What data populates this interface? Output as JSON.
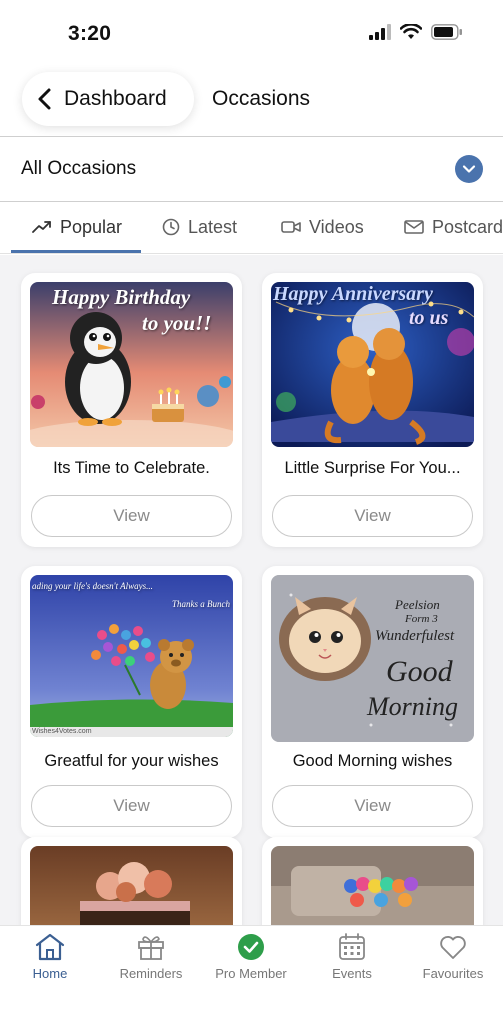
{
  "status_bar": {
    "time": "3:20"
  },
  "header": {
    "back_label": "Dashboard",
    "title": "Occasions"
  },
  "filter": {
    "label": "All Occasions"
  },
  "tabs": [
    {
      "label": "Popular",
      "icon": "trending-icon",
      "active": true
    },
    {
      "label": "Latest",
      "icon": "clock-icon",
      "active": false
    },
    {
      "label": "Videos",
      "icon": "video-icon",
      "active": false
    },
    {
      "label": "Postcard",
      "icon": "mail-icon",
      "active": false
    }
  ],
  "cards": [
    {
      "title": "Its Time to Celebrate.",
      "button": "View",
      "image_text": [
        "Happy Birthday",
        "to you!!"
      ]
    },
    {
      "title": "Little Surprise For You...",
      "button": "View",
      "image_text": [
        "Happy Anniversary",
        "to us"
      ]
    },
    {
      "title": "Greatful for your wishes",
      "button": "View",
      "image_text": [
        "ading your life's doesn't Always...",
        "Thanks a Bunch",
        "Wishes4Votes.com"
      ]
    },
    {
      "title": "Good Morning wishes",
      "button": "View",
      "image_text": [
        "Peelsion",
        "Form 3",
        "Wunderfulest",
        "Good",
        "Morning"
      ]
    },
    {
      "title": "",
      "button": ""
    },
    {
      "title": "",
      "button": ""
    }
  ],
  "bottom_nav": [
    {
      "label": "Home",
      "icon": "home-icon",
      "active": true
    },
    {
      "label": "Reminders",
      "icon": "gift-icon",
      "active": false
    },
    {
      "label": "Pro Member",
      "icon": "check-badge-icon",
      "active": false
    },
    {
      "label": "Events",
      "icon": "calendar-icon",
      "active": false
    },
    {
      "label": "Favourites",
      "icon": "heart-icon",
      "active": false
    }
  ],
  "colors": {
    "accent": "#4a73ad",
    "pro_badge": "#2e9e4a",
    "active_nav": "#3b5f92"
  }
}
